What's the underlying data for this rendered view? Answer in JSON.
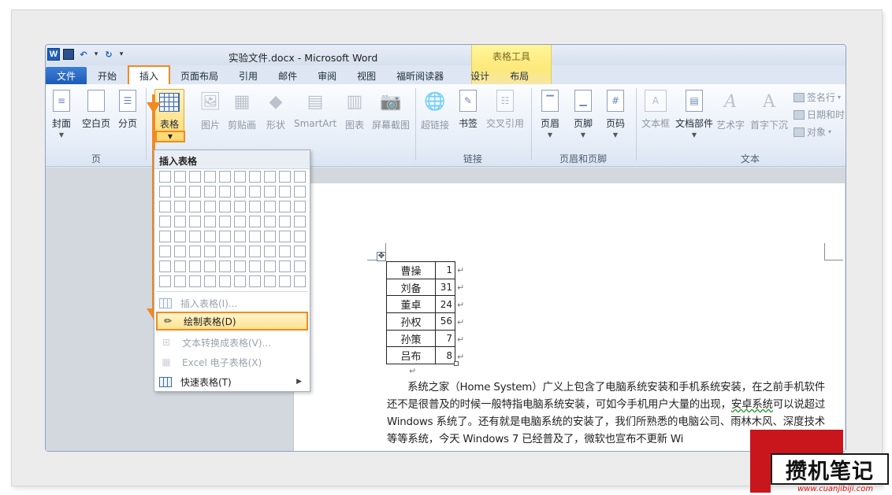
{
  "title_bar": {
    "title": "实验文件.docx - Microsoft Word",
    "context_tab_group": "表格工具"
  },
  "tabs": [
    {
      "label": "文件"
    },
    {
      "label": "开始"
    },
    {
      "label": "插入"
    },
    {
      "label": "页面布局"
    },
    {
      "label": "引用"
    },
    {
      "label": "邮件"
    },
    {
      "label": "审阅"
    },
    {
      "label": "视图"
    },
    {
      "label": "福昕阅读器"
    },
    {
      "label": "设计"
    },
    {
      "label": "布局"
    }
  ],
  "ribbon": {
    "cover": "封面",
    "blank_page": "空白页",
    "page_break": "分页",
    "table": "表格",
    "picture": "图片",
    "clip_art": "剪贴画",
    "shapes": "形状",
    "smartart": "SmartArt",
    "chart": "图表",
    "screenshot": "屏幕截图",
    "hyperlink": "超链接",
    "bookmark": "书签",
    "cross_reference": "交叉引用",
    "header": "页眉",
    "footer": "页脚",
    "page_number": "页码",
    "text_box": "文本框",
    "quick_parts": "文档部件",
    "wordart": "艺术字",
    "drop_cap": "首字下沉",
    "signature_line": "签名行",
    "date_time": "日期和时",
    "object": "对象",
    "groups": {
      "pages": "页",
      "links": "链接",
      "header_footer": "页眉和页脚",
      "text": "文本"
    }
  },
  "dropdown": {
    "title": "插入表格",
    "insert_table": "插入表格(I)...",
    "draw_table": "绘制表格(D)",
    "text_to_table": "文本转换成表格(V)...",
    "excel_table": "Excel 电子表格(X)",
    "quick_tables": "快速表格(T)"
  },
  "doc_table": [
    {
      "name": "曹操",
      "value": "1"
    },
    {
      "name": "刘备",
      "value": "31"
    },
    {
      "name": "董卓",
      "value": "24"
    },
    {
      "name": "孙权",
      "value": "56"
    },
    {
      "name": "孙策",
      "value": "7"
    },
    {
      "name": "吕布",
      "value": "8"
    }
  ],
  "paragraph": {
    "part1": "系统之家（Home System）广义上包含了电脑系统安装和手机系统安装，在之前手机软件还不是很普及的时候一般特指电脑系统安装，可如今手机用户大量的出现，",
    "part2": "安卓系统",
    "part3": "可以说超过 Windows 系统了。还有就是电脑系统的安装了，我们所熟悉的电脑公司、雨林木风、深度技术等等系统，今天 Windows 7 已经普及了，微软也宣布不更新 Wi"
  },
  "watermark": {
    "text": "攒机笔记",
    "url": "www.cuanjibiji.com"
  }
}
